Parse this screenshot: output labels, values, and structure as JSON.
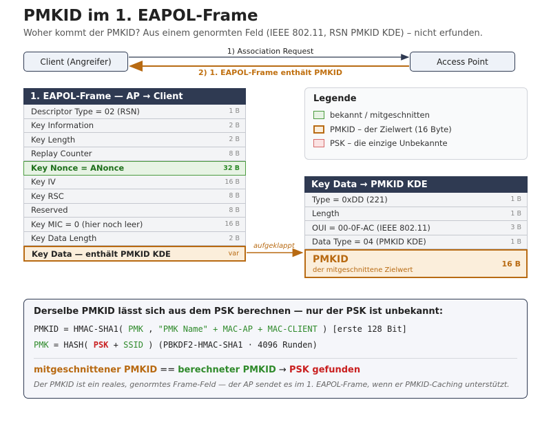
{
  "header": {
    "title": "PMKID im 1. EAPOL-Frame",
    "subtitle": "Woher kommt der PMKID? Aus einem genormten Feld (IEEE 802.11, RSN PMKID KDE) – nicht erfunden."
  },
  "flow": {
    "client": "Client (Angreifer)",
    "ap": "Access Point",
    "request": "1) Association Request",
    "response": "2) 1. EAPOL-Frame enthält PMKID"
  },
  "eapol": {
    "title": "1. EAPOL-Frame — AP → Client",
    "rows": [
      {
        "label": "Descriptor Type = 02 (RSN)",
        "size": "1 B"
      },
      {
        "label": "Key Information",
        "size": "2 B"
      },
      {
        "label": "Key Length",
        "size": "2 B"
      },
      {
        "label": "Replay Counter",
        "size": "8 B"
      },
      {
        "label": "Key Nonce = ANonce",
        "size": "32 B"
      },
      {
        "label": "Key IV",
        "size": "16 B"
      },
      {
        "label": "Key RSC",
        "size": "8 B"
      },
      {
        "label": "Reserved",
        "size": "8 B"
      },
      {
        "label": "Key MIC = 0 (hier noch leer)",
        "size": "16 B"
      },
      {
        "label": "Key Data Length",
        "size": "2 B"
      },
      {
        "label": "Key Data — enthält PMKID KDE",
        "size": "var"
      }
    ]
  },
  "unfold_label": "aufgeklappt",
  "legend": {
    "title": "Legende",
    "items": [
      "bekannt / mitgeschnitten",
      "PMKID – der Zielwert (16 Byte)",
      "PSK – die einzige Unbekannte"
    ]
  },
  "kde": {
    "title": "Key Data → PMKID KDE",
    "rows": [
      {
        "label": "Type = 0xDD (221)",
        "size": "1 B"
      },
      {
        "label": "Length",
        "size": "1 B"
      },
      {
        "label": "OUI = 00-0F-AC (IEEE 802.11)",
        "size": "3 B"
      },
      {
        "label": "Data Type = 04 (PMKID KDE)",
        "size": "1 B"
      }
    ],
    "pmkid": {
      "name": "PMKID",
      "sub": "der mitgeschnittene Zielwert",
      "size": "16 B"
    }
  },
  "calc": {
    "title": "Derselbe PMKID lässt sich aus dem PSK berechnen — nur der PSK ist unbekannt:",
    "f1": {
      "a": "PMKID = HMAC-SHA1( ",
      "b": "PMK",
      "c": " , ",
      "d": "\"PMK Name\" + MAC-AP + MAC-CLIENT",
      "e": " ) [erste 128 Bit]"
    },
    "f2": {
      "a": "PMK",
      "b": " = HASH( ",
      "c": "PSK",
      "d": " + ",
      "e": "SSID",
      "f": " ) (PBKDF2-HMAC-SHA1 · 4096 Runden)"
    },
    "result": {
      "a": "mitgeschnittener PMKID",
      "b": " == ",
      "c": "berechneter PMKID",
      "d": " → ",
      "e": "PSK gefunden"
    },
    "note": "Der PMKID ist ein reales, genormtes Frame-Feld — der AP sendet es im 1. EAPOL-Frame, wenn er PMKID-Caching unterstützt."
  }
}
